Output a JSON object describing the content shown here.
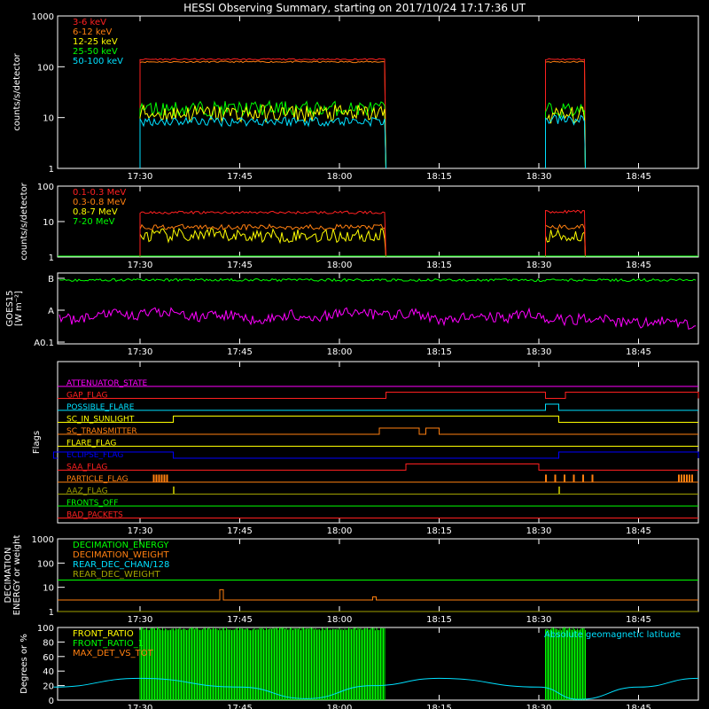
{
  "title": "HESSI Observing Summary, starting on 2017/10/24 17:17:36 UT",
  "time_axis": {
    "start": "17:17:36",
    "end": "18:54",
    "ticks": [
      "17:30",
      "17:45",
      "18:00",
      "18:15",
      "18:30",
      "18:45"
    ]
  },
  "colors": {
    "background": "#000000",
    "axes": "#ffffff",
    "red": "#ff2020",
    "orange": "#ff7f10",
    "yellow": "#ffff00",
    "green": "#00ff00",
    "cyan": "#00e0ff",
    "magenta": "#ff00ff",
    "blue": "#0000ff"
  },
  "chart_data": [
    {
      "id": "panel1",
      "type": "line",
      "ylabel": "counts/s/detector",
      "yscale": "log",
      "ylim": [
        1,
        1000
      ],
      "yticks": [
        "1",
        "10",
        "100",
        "1000"
      ],
      "legend": [
        "3-6 keV",
        "6-12 keV",
        "12-25 keV",
        "25-50 keV",
        "50-100 keV"
      ],
      "legend_position": "top-left",
      "series": [
        {
          "name": "3-6 keV",
          "color": "red",
          "segments": [
            {
              "from": "17:30",
              "to": "18:07",
              "value": 140
            },
            {
              "from": "18:31",
              "to": "18:37",
              "value": 140
            }
          ]
        },
        {
          "name": "6-12 keV",
          "color": "orange",
          "segments": [
            {
              "from": "17:30",
              "to": "18:07",
              "value": 125
            },
            {
              "from": "18:31",
              "to": "18:37",
              "value": 125
            }
          ]
        },
        {
          "name": "12-25 keV",
          "color": "yellow",
          "segments": [
            {
              "from": "17:30",
              "to": "18:07",
              "value": 12
            },
            {
              "from": "18:31",
              "to": "18:37",
              "value": 11
            }
          ]
        },
        {
          "name": "25-50 keV",
          "color": "green",
          "segments": [
            {
              "from": "17:30",
              "to": "18:07",
              "value": 15
            },
            {
              "from": "18:31",
              "to": "18:37",
              "value": 14
            }
          ]
        },
        {
          "name": "50-100 keV",
          "color": "cyan",
          "segments": [
            {
              "from": "17:30",
              "to": "18:07",
              "value": 8.5
            },
            {
              "from": "18:31",
              "to": "18:37",
              "value": 9
            }
          ]
        }
      ]
    },
    {
      "id": "panel2",
      "type": "line",
      "ylabel": "counts/s/detector",
      "yscale": "log",
      "ylim": [
        1,
        100
      ],
      "yticks": [
        "1",
        "10",
        "100"
      ],
      "legend": [
        "0.1-0.3 MeV",
        "0.3-0.8 MeV",
        "0.8-7 MeV",
        "7-20 MeV"
      ],
      "legend_position": "top-left",
      "series": [
        {
          "name": "0.1-0.3 MeV",
          "color": "red",
          "segments": [
            {
              "from": "17:30",
              "to": "18:07",
              "value": 18
            },
            {
              "from": "18:31",
              "to": "18:37",
              "value": 19
            }
          ]
        },
        {
          "name": "0.3-0.8 MeV",
          "color": "orange",
          "segments": [
            {
              "from": "17:30",
              "to": "18:07",
              "value": 7
            },
            {
              "from": "18:31",
              "to": "18:37",
              "value": 7
            }
          ]
        },
        {
          "name": "0.8-7 MeV",
          "color": "yellow",
          "segments": [
            {
              "from": "17:30",
              "to": "18:07",
              "value": 4
            },
            {
              "from": "18:31",
              "to": "18:37",
              "value": 4
            }
          ]
        },
        {
          "name": "7-20 MeV",
          "color": "green",
          "segments": []
        }
      ]
    },
    {
      "id": "panel3",
      "type": "line",
      "ylabel": "GOES15",
      "ylabel2": "[W m⁻²]",
      "yticks": [
        "A0.1",
        "A",
        "B"
      ],
      "series": [
        {
          "name": "long",
          "color": "magenta",
          "level": "A",
          "value": 1.0
        },
        {
          "name": "short",
          "color": "green",
          "level": "B",
          "value": 10.0
        }
      ]
    },
    {
      "id": "flags",
      "type": "step",
      "ylabel": "Flags",
      "rows": [
        {
          "label": "ATTENUATOR_STATE",
          "color": "magenta",
          "changes": []
        },
        {
          "label": "GAP_FLAG",
          "color": "red",
          "changes": [
            [
              "18:07",
              "18:31",
              "high"
            ],
            [
              "18:34",
              "18:54",
              "high"
            ]
          ]
        },
        {
          "label": "POSSIBLE_FLARE",
          "color": "cyan",
          "changes": [
            [
              "18:31",
              "18:33",
              "high"
            ]
          ]
        },
        {
          "label": "SC_IN_SUNLIGHT",
          "color": "yellow",
          "changes": [
            [
              "17:35",
              "18:33",
              "high"
            ]
          ]
        },
        {
          "label": "SC_TRANSMITTER",
          "color": "orange",
          "changes": [
            [
              "18:06",
              "18:12",
              "high"
            ],
            [
              "18:13",
              "18:15",
              "high"
            ]
          ]
        },
        {
          "label": "FLARE_FLAG",
          "color": "yellow",
          "changes": []
        },
        {
          "label": "ECLIPSE_FLAG",
          "color": "blue",
          "changes": [
            [
              "17:17",
              "17:35",
              "high"
            ],
            [
              "18:33",
              "18:54",
              "high"
            ]
          ]
        },
        {
          "label": "SAA_FLAG",
          "color": "red",
          "changes": [
            [
              "18:10",
              "18:30",
              "high"
            ]
          ]
        },
        {
          "label": "PARTICLE_FLAG",
          "color": "orange",
          "changes": [
            [
              "17:32",
              "17:34",
              "spikes"
            ],
            [
              "18:31",
              "18:38",
              "spikes"
            ],
            [
              "18:51",
              "18:53",
              "spikes"
            ]
          ]
        },
        {
          "label": "AAZ_FLAG",
          "color": "olive",
          "changes": [
            [
              "17:35",
              "17:35",
              "spike"
            ],
            [
              "18:33",
              "18:33",
              "spike"
            ]
          ]
        },
        {
          "label": "FRONTS_OFF",
          "color": "green",
          "changes": []
        },
        {
          "label": "BAD_PACKETS",
          "color": "red",
          "changes": []
        }
      ]
    },
    {
      "id": "panel5",
      "type": "line",
      "ylabel": "DECIMATION",
      "ylabel2": "ENERGY or weight",
      "yscale": "log",
      "ylim": [
        1,
        1000
      ],
      "yticks": [
        "1",
        "10",
        "100",
        "1000"
      ],
      "legend": [
        "DECIMATION_ENERGY",
        "DECIMATION_WEIGHT",
        "REAR_DEC_CHAN/128",
        "REAR_DEC_WEIGHT"
      ],
      "legend_position": "top-left",
      "series": [
        {
          "name": "DECIMATION_ENERGY",
          "color": "green",
          "value": 20
        },
        {
          "name": "DECIMATION_WEIGHT",
          "color": "orange",
          "value": 3,
          "spikes": [
            [
              "17:42",
              8
            ],
            [
              "18:05",
              4
            ]
          ]
        },
        {
          "name": "REAR_DEC_CHAN/128",
          "color": "cyan",
          "value": 1
        },
        {
          "name": "REAR_DEC_WEIGHT",
          "color": "olive",
          "value": 1
        }
      ]
    },
    {
      "id": "panel6",
      "type": "line",
      "ylabel": "Degrees or %",
      "ylim": [
        0,
        100
      ],
      "yticks": [
        "0",
        "20",
        "40",
        "60",
        "80",
        "100"
      ],
      "legend": [
        "FRONT_RATIO",
        "FRONT_RATIO_1",
        "MAX_DET_VS_TOT"
      ],
      "legend_position": "top-left",
      "annotation": "Absolute geomagnetic latitude",
      "series": [
        {
          "name": "FRONT_RATIO",
          "color": "green",
          "segments": [
            {
              "from": "17:30",
              "to": "18:07",
              "value": "0-100 rapid oscillation"
            },
            {
              "from": "18:31",
              "to": "18:37",
              "value": "0-100 rapid oscillation"
            }
          ]
        },
        {
          "name": "Absolute geomagnetic latitude",
          "color": "cyan",
          "points": [
            [
              "17:17",
              18
            ],
            [
              "17:30",
              30
            ],
            [
              "17:45",
              18
            ],
            [
              "17:55",
              2
            ],
            [
              "18:05",
              20
            ],
            [
              "18:15",
              30
            ],
            [
              "18:30",
              18
            ],
            [
              "18:36",
              1
            ],
            [
              "18:45",
              18
            ],
            [
              "18:54",
              30
            ]
          ]
        }
      ]
    }
  ]
}
